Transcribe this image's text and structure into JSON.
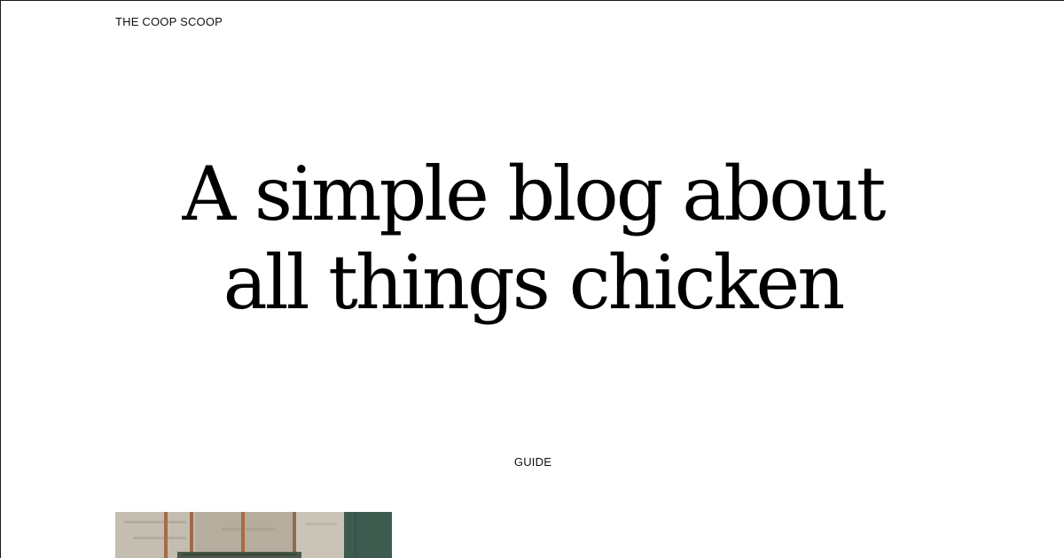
{
  "header": {
    "site_title": "THE COOP SCOOP"
  },
  "hero": {
    "line1": "A simple blog about",
    "line2": "all things chicken"
  },
  "featured": {
    "category": "GUIDE"
  },
  "colors": {
    "background": "#ffffff",
    "text": "#000000",
    "image_wall": "#b9b2a6",
    "image_door": "#3e5b50",
    "image_post": "#a86a45"
  }
}
